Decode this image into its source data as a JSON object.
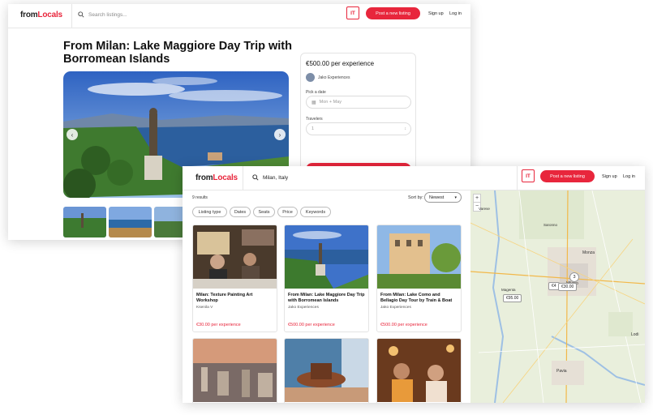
{
  "back_page": {
    "logo_main": "from",
    "logo_accent": "Locals",
    "search_placeholder": "Search listings...",
    "lang": "IT",
    "post_button": "Post a new listing",
    "signup": "Sign up",
    "login": "Log in",
    "title": "From Milan: Lake Maggiore Day Trip with Borromean Islands",
    "price": "€500.00 per experience",
    "host": "Jako Experiences",
    "date_label": "Pick a date",
    "date_placeholder": "Mon + May",
    "travelers_label": "Travelers",
    "travelers_value": "1"
  },
  "front_page": {
    "logo_main": "from",
    "logo_accent": "Locals",
    "search_value": "Milan, Italy",
    "lang": "IT",
    "post_button": "Post a new listing",
    "signup": "Sign up",
    "login": "Log in",
    "results_count": "9 results",
    "sort_label": "Sort by:",
    "sort_value": "Newest",
    "filters": [
      "Listing type",
      "Dates",
      "Seats",
      "Price",
      "Keywords"
    ],
    "listings": [
      {
        "title": "Milan: Texture Painting Art Workshop",
        "host": "Ksenila V",
        "price": "€30.00 per experience"
      },
      {
        "title": "From Milan: Lake Maggiore Day Trip with Borromean Islands",
        "host": "Jako Experiences",
        "price": "€500.00 per experience"
      },
      {
        "title": "From Milan: Lake Como and Bellagio Day Tour by Train & Boat",
        "host": "Jako Experiences",
        "price": "€500.00 per experience"
      },
      {
        "title": "",
        "host": "",
        "price": ""
      },
      {
        "title": "",
        "host": "",
        "price": ""
      },
      {
        "title": "",
        "host": "",
        "price": ""
      }
    ],
    "map": {
      "zoom_in": "+",
      "zoom_out": "−",
      "cluster": "3",
      "pins": [
        "€95.00",
        "€30.00",
        "€4"
      ],
      "places": [
        "Monza",
        "Milano",
        "Lodi",
        "Pavia",
        "Magenta",
        "Saronno",
        "Varese"
      ]
    }
  },
  "colors": {
    "accent": "#e8263c",
    "map_bg": "#e9efdc"
  }
}
